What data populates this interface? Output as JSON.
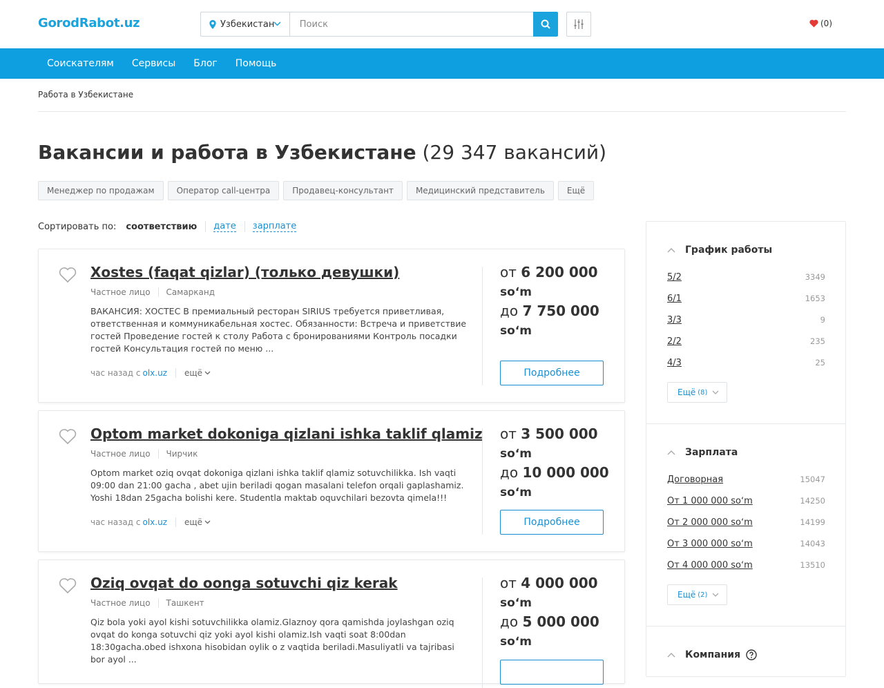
{
  "header": {
    "logo": "GorodRabot.uz",
    "region": "Узбекистан",
    "search_placeholder": "Поиск",
    "favorites_count": "(0)"
  },
  "nav": [
    "Соискателям",
    "Сервисы",
    "Блог",
    "Помощь"
  ],
  "breadcrumb": "Работа в Узбекистане",
  "page": {
    "title": "Вакансии и работа в Узбекистане",
    "count": "(29 347 вакансий)"
  },
  "tags": [
    "Менеджер по продажам",
    "Оператор call-центра",
    "Продавец-консультант",
    "Медицинский представитель",
    "Ещё"
  ],
  "sort": {
    "label": "Сортировать по:",
    "current": "соответствию",
    "options": [
      "дате",
      "зарплате"
    ]
  },
  "vacancies": [
    {
      "title": "Xostes (faqat qizlar) (только девушки)",
      "employer": "Частное лицо",
      "city": "Самарканд",
      "description": "ВАКАНСИЯ: ХОСТЕС В премиальный ресторан SIRIUS требуется приветливая, ответственная и коммуникабельная хостес. Обязанности: Встреча и приветствие гостей Проведение гостей к столу Работа с бронированиями Контроль посадки гостей Консультация гостей по меню ...",
      "time": "час назад с",
      "source": "olx.uz",
      "more": "ещё",
      "from_prefix": "от",
      "from": "6 200 000",
      "to_prefix": "до",
      "to": "7 750 000",
      "currency": "soʻm",
      "button": "Подробнее"
    },
    {
      "title": "Optom market dokoniga qizlani ishka taklif qlamiz",
      "employer": "Частное лицо",
      "city": "Чирчик",
      "description": "Optom market oziq ovqat dokoniga qizlani ishka taklif qlamiz sotuvchilikka. Ish vaqti 09:00 dan 21:00 gacha , abet ujin beriladi qogan masalani telefon orqali gaplashamiz. Yoshi 18dan 25gacha bolishi kere. Studentla maktab oquvchilari bezovta qimela!!!",
      "time": "час назад с",
      "source": "olx.uz",
      "more": "ещё",
      "from_prefix": "от",
      "from": "3 500 000",
      "to_prefix": "до",
      "to": "10 000 000",
      "currency": "soʻm",
      "button": "Подробнее"
    },
    {
      "title": "Oziq ovqat do oonga sotuvchi qiz kerak",
      "employer": "Частное лицо",
      "city": "Ташкент",
      "description": "Qiz bola yoki ayol kishi sotuvchilikka olamiz.Glaznoy qora qamishda joylashgan oziq ovqat do konga sotuvchi qiz yoki ayol kishi olamiz.Ish vaqti soat 8:00dan 18:30gacha.obed ishxona hisobidan oylik o z vaqtida beriladi.Masuliyatli va tajribasi bor ayol ...",
      "from_prefix": "от",
      "from": "4 000 000",
      "to_prefix": "до",
      "to": "5 000 000",
      "currency": "soʻm"
    }
  ],
  "sidebar": {
    "schedule": {
      "title": "График работы",
      "items": [
        {
          "label": "5/2",
          "count": "3349"
        },
        {
          "label": "6/1",
          "count": "1653"
        },
        {
          "label": "3/3",
          "count": "9"
        },
        {
          "label": "2/2",
          "count": "235"
        },
        {
          "label": "4/3",
          "count": "25"
        }
      ],
      "more": "Ещё",
      "more_count": "(8)"
    },
    "salary": {
      "title": "Зарплата",
      "items": [
        {
          "label": "Договорная",
          "count": "15047"
        },
        {
          "label": "От 1 000 000 soʻm",
          "count": "14250"
        },
        {
          "label": "От 2 000 000 soʻm",
          "count": "14199"
        },
        {
          "label": "От 3 000 000 soʻm",
          "count": "14043"
        },
        {
          "label": "От 4 000 000 soʻm",
          "count": "13510"
        }
      ],
      "more": "Ещё",
      "more_count": "(2)"
    },
    "company": {
      "title": "Компания"
    }
  },
  "colors": {
    "brand": "#1aa3dc",
    "nav": "#0e9fe0",
    "link": "#1a8fd0",
    "heart": "#e53935"
  }
}
